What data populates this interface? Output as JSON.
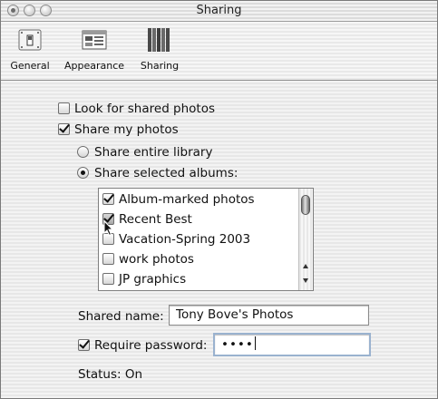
{
  "window": {
    "title": "Sharing"
  },
  "toolbar": {
    "items": [
      {
        "label": "General",
        "icon": "general-switch-icon"
      },
      {
        "label": "Appearance",
        "icon": "appearance-window-icon"
      },
      {
        "label": "Sharing",
        "icon": "sharing-books-icon"
      }
    ]
  },
  "options": {
    "look_shared": {
      "label": "Look for shared photos",
      "checked": false
    },
    "share_my": {
      "label": "Share my photos",
      "checked": true
    },
    "share_entire": {
      "label": "Share entire library",
      "selected": false
    },
    "share_selected": {
      "label": "Share selected albums:",
      "selected": true
    }
  },
  "albums": [
    {
      "label": "Album-marked photos",
      "checked": true
    },
    {
      "label": "Recent Best",
      "checked": true
    },
    {
      "label": "Vacation-Spring 2003",
      "checked": false
    },
    {
      "label": "work photos",
      "checked": false
    },
    {
      "label": "JP graphics",
      "checked": false
    }
  ],
  "shared_name": {
    "label": "Shared name:",
    "value": "Tony Bove's Photos"
  },
  "require_password": {
    "label": "Require password:",
    "checked": true,
    "value": "••••"
  },
  "status": {
    "text": "Status: On"
  }
}
